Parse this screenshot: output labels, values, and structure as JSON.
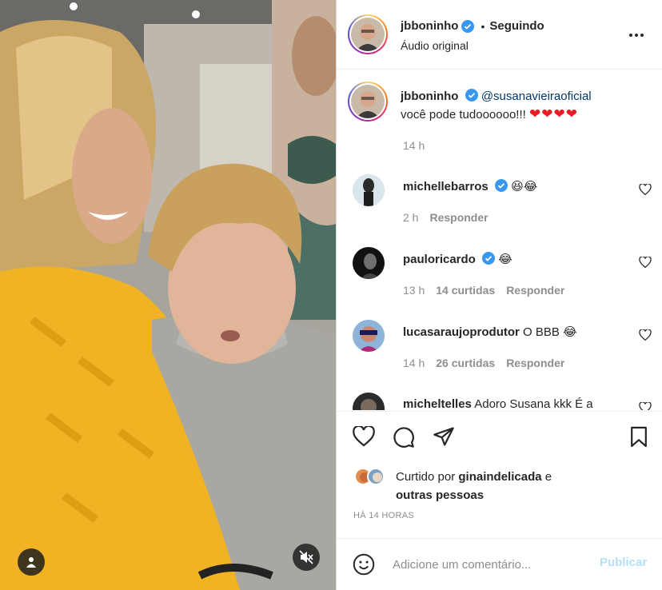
{
  "post": {
    "author": "jbboninho",
    "follow_status": "Seguindo",
    "dot": "•",
    "audio": "Áudio original"
  },
  "caption": {
    "username": "jbboninho",
    "mention": "@susanavieiraoficial",
    "text": "você pode tudoooooo!!!",
    "hearts": "❤❤❤❤",
    "time": "14 h"
  },
  "comments": [
    {
      "username": "michellebarros",
      "verified": true,
      "text": "",
      "emoji": "😆😂",
      "time": "2 h",
      "likes": "",
      "reply": "Responder"
    },
    {
      "username": "pauloricardo",
      "verified": true,
      "text": "",
      "emoji": "😂",
      "time": "13 h",
      "likes": "14 curtidas",
      "reply": "Responder"
    },
    {
      "username": "lucasaraujoprodutor",
      "verified": false,
      "text": "O BBB",
      "emoji": "😂",
      "time": "14 h",
      "likes": "26 curtidas",
      "reply": "Responder"
    },
    {
      "username": "micheltelles",
      "verified": false,
      "text": "Adoro Susana kkk É a",
      "emoji": "",
      "time": "",
      "likes": "",
      "reply": ""
    }
  ],
  "likes_summary": {
    "prefix": "Curtido por",
    "user": "ginaindelicada",
    "conj": "e",
    "others": "outras pessoas"
  },
  "timestamp": "HÁ 14 HORAS",
  "composer": {
    "placeholder": "Adicione um comentário...",
    "post_label": "Publicar"
  },
  "colors": {
    "verified": "#3897f0",
    "link": "#00376b",
    "muted": "#8e8e8e",
    "post_disabled": "#b2dffc",
    "sweater": "#f0b323"
  },
  "icons": [
    "verified-icon",
    "more-icon",
    "heart-icon",
    "comment-icon",
    "share-icon",
    "bookmark-icon",
    "emoji-icon",
    "user-tag-icon",
    "mute-icon"
  ]
}
